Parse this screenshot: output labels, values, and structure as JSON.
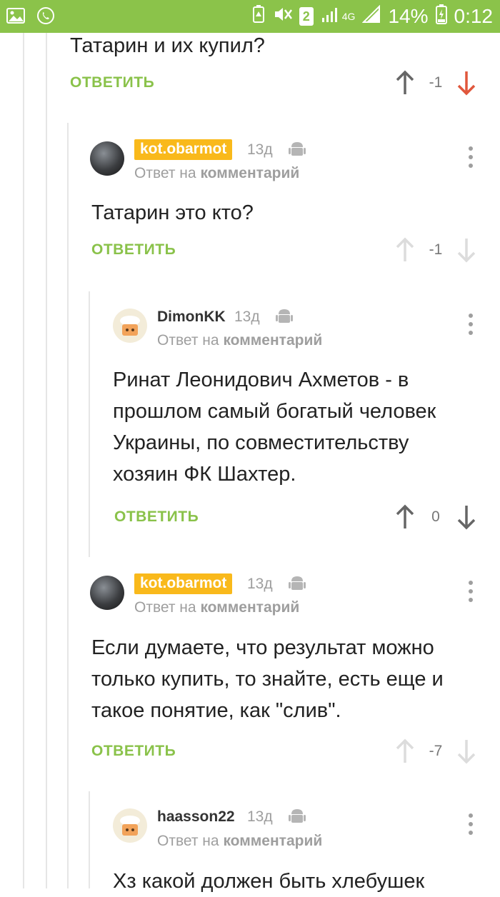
{
  "status": {
    "battery": "14%",
    "time": "0:12",
    "sim": "2",
    "network": "4G"
  },
  "colors": {
    "accent": "#8ac24a",
    "badge": "#f9b91b",
    "downvote_active": "#e0573c",
    "status_bar": "#8bc34a"
  },
  "top": {
    "text": "Татарин и их купил?",
    "reply": "ОТВЕТИТЬ",
    "rating": "-1"
  },
  "comments": [
    {
      "user": "kot.obarmot",
      "age": "13д",
      "reply_prefix": "Ответ на",
      "reply_link": "комментарий",
      "lines": [
        "Татарин это кто?"
      ],
      "reply": "ОТВЕТИТЬ",
      "rating": "-1"
    },
    {
      "user": "DimonKK",
      "age": "13д",
      "reply_prefix": "Ответ на",
      "reply_link": "комментарий",
      "lines": [
        "Ринат Леонидович Ахметов - в",
        "прошлом самый богатый человек",
        "Украины, по совместительству",
        "хозяин ФК Шахтер."
      ],
      "reply": "ОТВЕТИТЬ",
      "rating": "0"
    },
    {
      "user": "kot.obarmot",
      "age": "13д",
      "reply_prefix": "Ответ на",
      "reply_link": "комментарий",
      "lines": [
        "Если думаете, что результат можно",
        "только купить, то знайте, есть еще и",
        "такое понятие, как \"слив\"."
      ],
      "reply": "ОТВЕТИТЬ",
      "rating": "-7"
    },
    {
      "user": "haasson22",
      "age": "13д",
      "reply_prefix": "Ответ на",
      "reply_link": "комментарий",
      "lines": [
        "Хз какой должен быть хлебушек"
      ]
    }
  ]
}
